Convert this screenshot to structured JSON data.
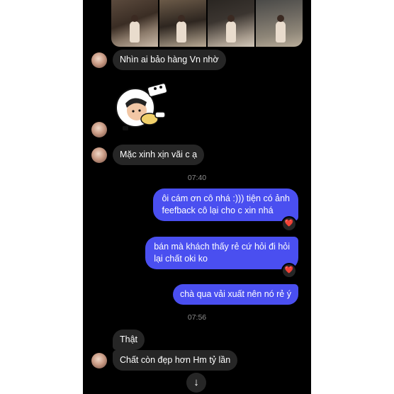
{
  "messages": {
    "m1": "Nhìn ai bảo hàng Vn nhờ",
    "m2": "Mặc xinh xịn vãi c ạ",
    "m3_line1": "ôi cám ơn cô nhá :))) tiện có ảnh",
    "m3_line2": "feefback cô lại cho c xin nhá",
    "m4_line1": "bán mà khách thấy rẻ cứ hỏi đi hỏi",
    "m4_line2": "lại chất oki ko",
    "m5": "chà qua vải xuất nên nó rẻ ý",
    "m6": "Thật",
    "m7": "Chất còn đẹp hơn Hm tỷ lần"
  },
  "timestamps": {
    "t1": "07:40",
    "t2": "07:56"
  },
  "reactions": {
    "heart": "❤️"
  },
  "icons": {
    "scroll_down": "↓"
  },
  "colors": {
    "outgoing_bubble": "#4a4ff0",
    "incoming_bubble": "#262626",
    "background": "#000000"
  }
}
